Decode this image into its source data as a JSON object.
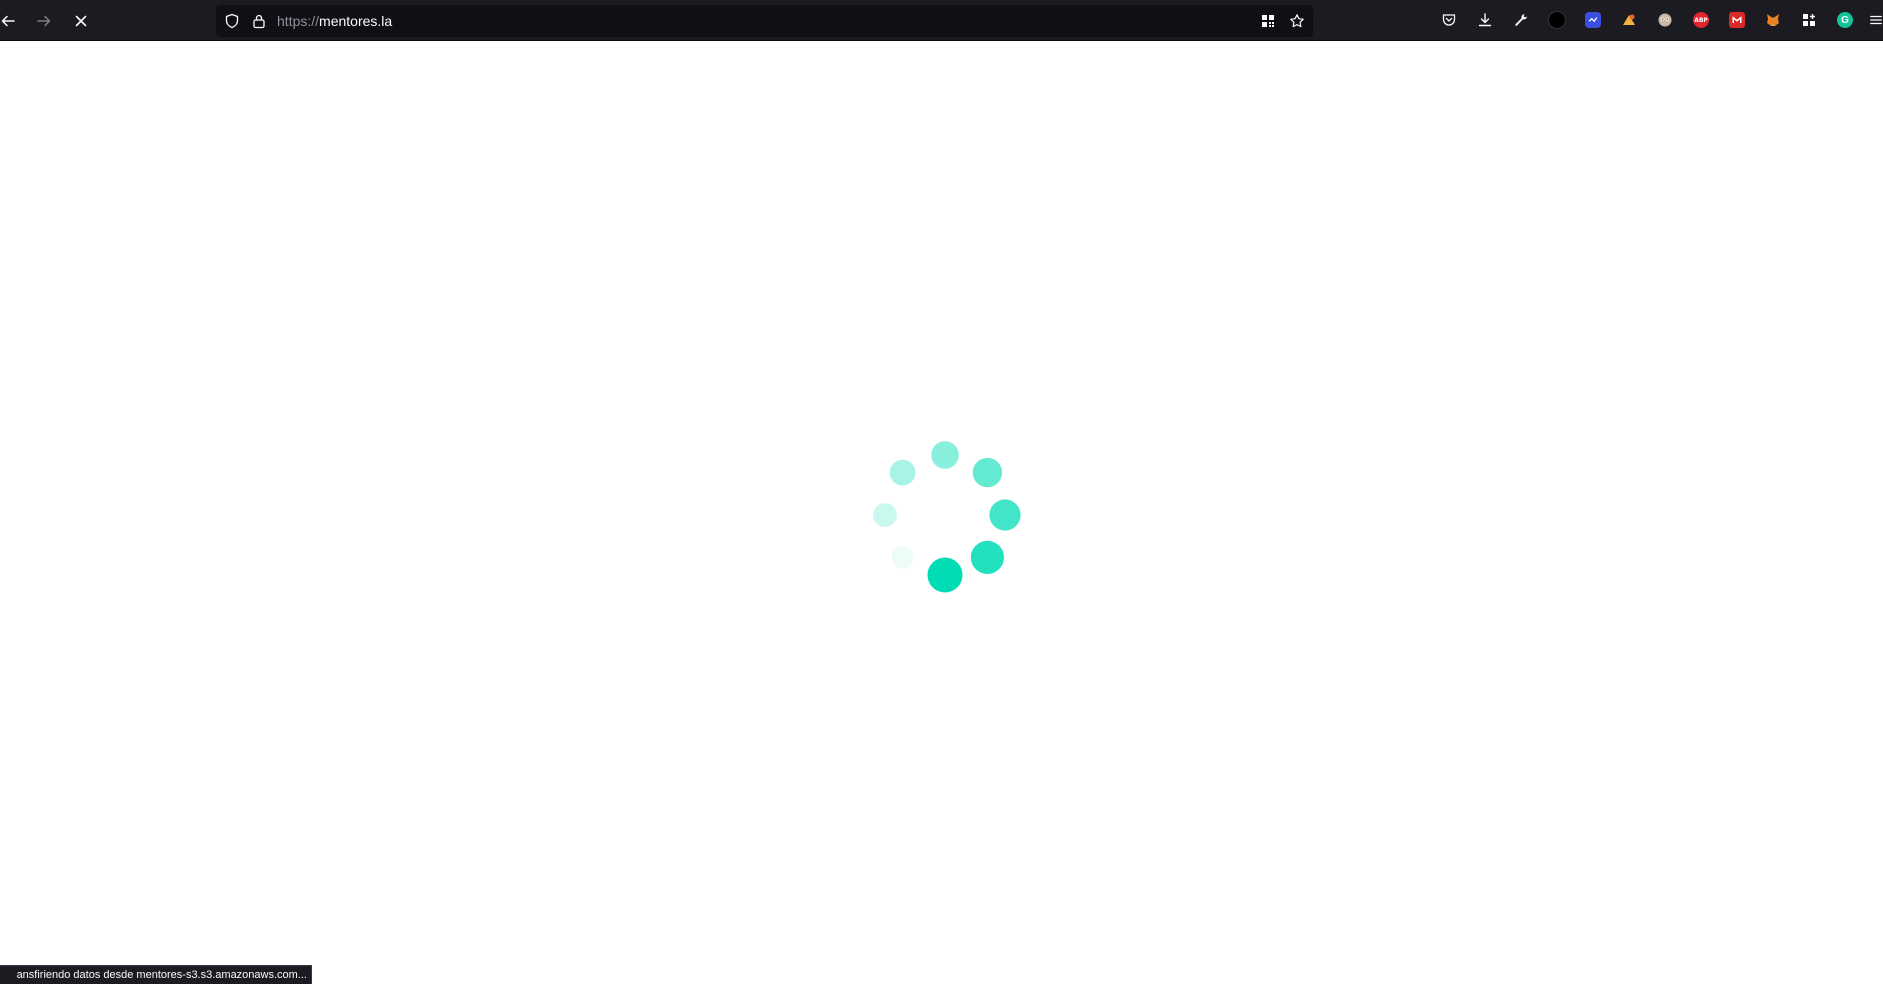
{
  "browser": {
    "url_scheme": "https://",
    "url_host": "mentores.la",
    "nav": {
      "back_icon": "back-arrow-icon",
      "forward_icon": "forward-arrow-icon",
      "stop_icon": "stop-loading-icon"
    },
    "urlbar_icons": [
      "tracking-protection-shield-icon",
      "lock-icon",
      "qr-code-icon",
      "bookmark-star-icon"
    ],
    "toolbar_icons": [
      "pocket-icon",
      "downloads-icon",
      "developer-tools-wrench-icon",
      "extension-black-circle-icon",
      "extension-blue-icon",
      "extension-yellow-icon",
      "extension-face-icon",
      "adblock-plus-icon",
      "extension-red-icon",
      "metamask-fox-icon",
      "extensions-grid-icon",
      "grammarly-icon",
      "menu-hamburger-icon"
    ],
    "abp_label": "ABP",
    "grammarly_label": "G"
  },
  "page": {
    "loading_spinner": {
      "color": "#00dcb4",
      "dot_count": 8
    }
  },
  "status_bar": {
    "text": "ansfiriendo datos desde mentores-s3.s3.amazonaws.com..."
  },
  "colors": {
    "toolbar_bg": "#1c1b22",
    "urlbar_bg": "#101014",
    "accent_teal": "#00dcb4"
  }
}
